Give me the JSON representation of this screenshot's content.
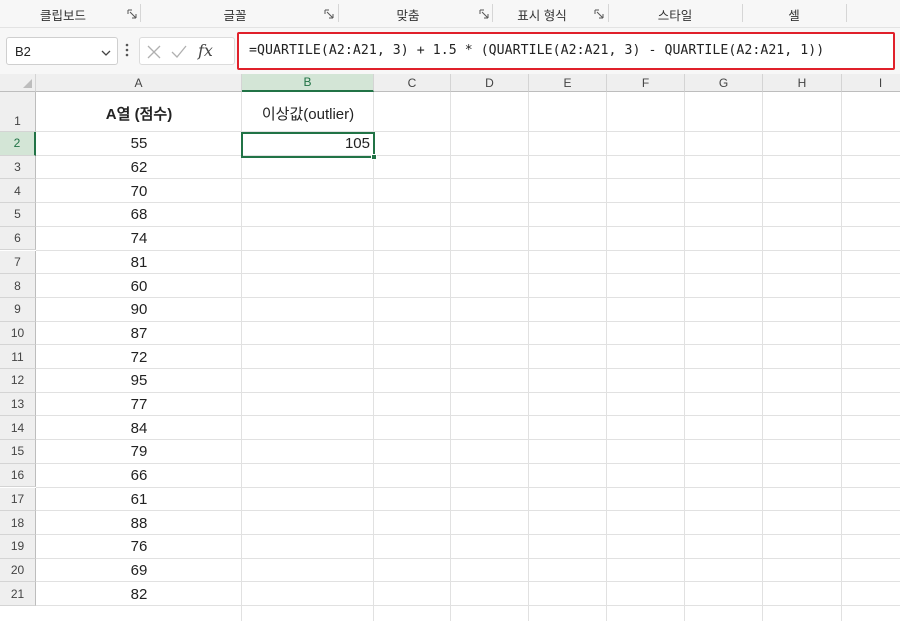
{
  "ribbon": {
    "groups": [
      {
        "label": "클립보드",
        "launcher": true
      },
      {
        "label": "글꼴",
        "launcher": true
      },
      {
        "label": "맞춤",
        "launcher": true
      },
      {
        "label": "표시 형식",
        "launcher": true
      },
      {
        "label": "스타일",
        "launcher": false
      },
      {
        "label": "셀",
        "launcher": false
      }
    ]
  },
  "formula_bar": {
    "name_box": "B2",
    "fx_label": "fx",
    "formula": "=QUARTILE(A2:A21, 3) + 1.5 * (QUARTILE(A2:A21, 3) - QUARTILE(A2:A21, 1))"
  },
  "sheet": {
    "columns": [
      "A",
      "B",
      "C",
      "D",
      "E",
      "F",
      "G",
      "H",
      "I"
    ],
    "selected_column": "B",
    "selected_row": 2,
    "rows": [
      1,
      2,
      3,
      4,
      5,
      6,
      7,
      8,
      9,
      10,
      11,
      12,
      13,
      14,
      15,
      16,
      17,
      18,
      19,
      20,
      21
    ],
    "header_a": "A열 (점수)",
    "header_b": "이상값(outlier)",
    "b2_value": "105",
    "a_values": [
      "55",
      "62",
      "70",
      "68",
      "74",
      "81",
      "60",
      "90",
      "87",
      "72",
      "95",
      "77",
      "84",
      "79",
      "66",
      "61",
      "88",
      "76",
      "69",
      "82"
    ]
  }
}
